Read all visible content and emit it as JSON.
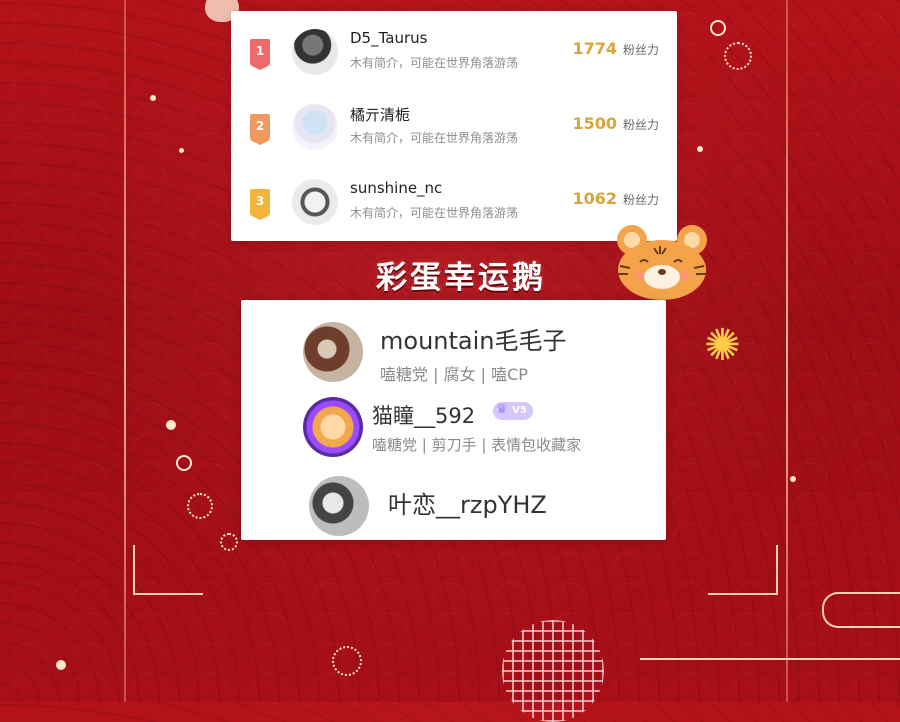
{
  "ranking": {
    "items": [
      {
        "rank": "1",
        "name": "D5_Taurus",
        "desc": "木有简介，可能在世界角落游荡",
        "fans_count": "1774",
        "fans_label": "粉丝力",
        "badge_color": "#ec6a6a"
      },
      {
        "rank": "2",
        "name": "橘亓清栀",
        "desc": "木有简介，可能在世界角落游荡",
        "fans_count": "1500",
        "fans_label": "粉丝力",
        "badge_color": "#f1985e"
      },
      {
        "rank": "3",
        "name": "sunshine_nc",
        "desc": "木有简介，可能在世界角落游荡",
        "fans_count": "1062",
        "fans_label": "粉丝力",
        "badge_color": "#f3b43b"
      }
    ]
  },
  "section_title": "彩蛋幸运鹅",
  "lucky": {
    "items": [
      {
        "name": "mountain毛毛子",
        "tags": "嗑糖党 | 腐女 | 嗑CP"
      },
      {
        "name": "猫瞳__592",
        "tags": "嗑糖党 | 剪刀手 | 表情包收藏家",
        "badge": "V5"
      },
      {
        "name": "叶恋__rzpYHZ",
        "tags": ""
      }
    ]
  },
  "colors": {
    "background": "#a80f18",
    "gold": "#d8a53c",
    "card": "#ffffff"
  }
}
